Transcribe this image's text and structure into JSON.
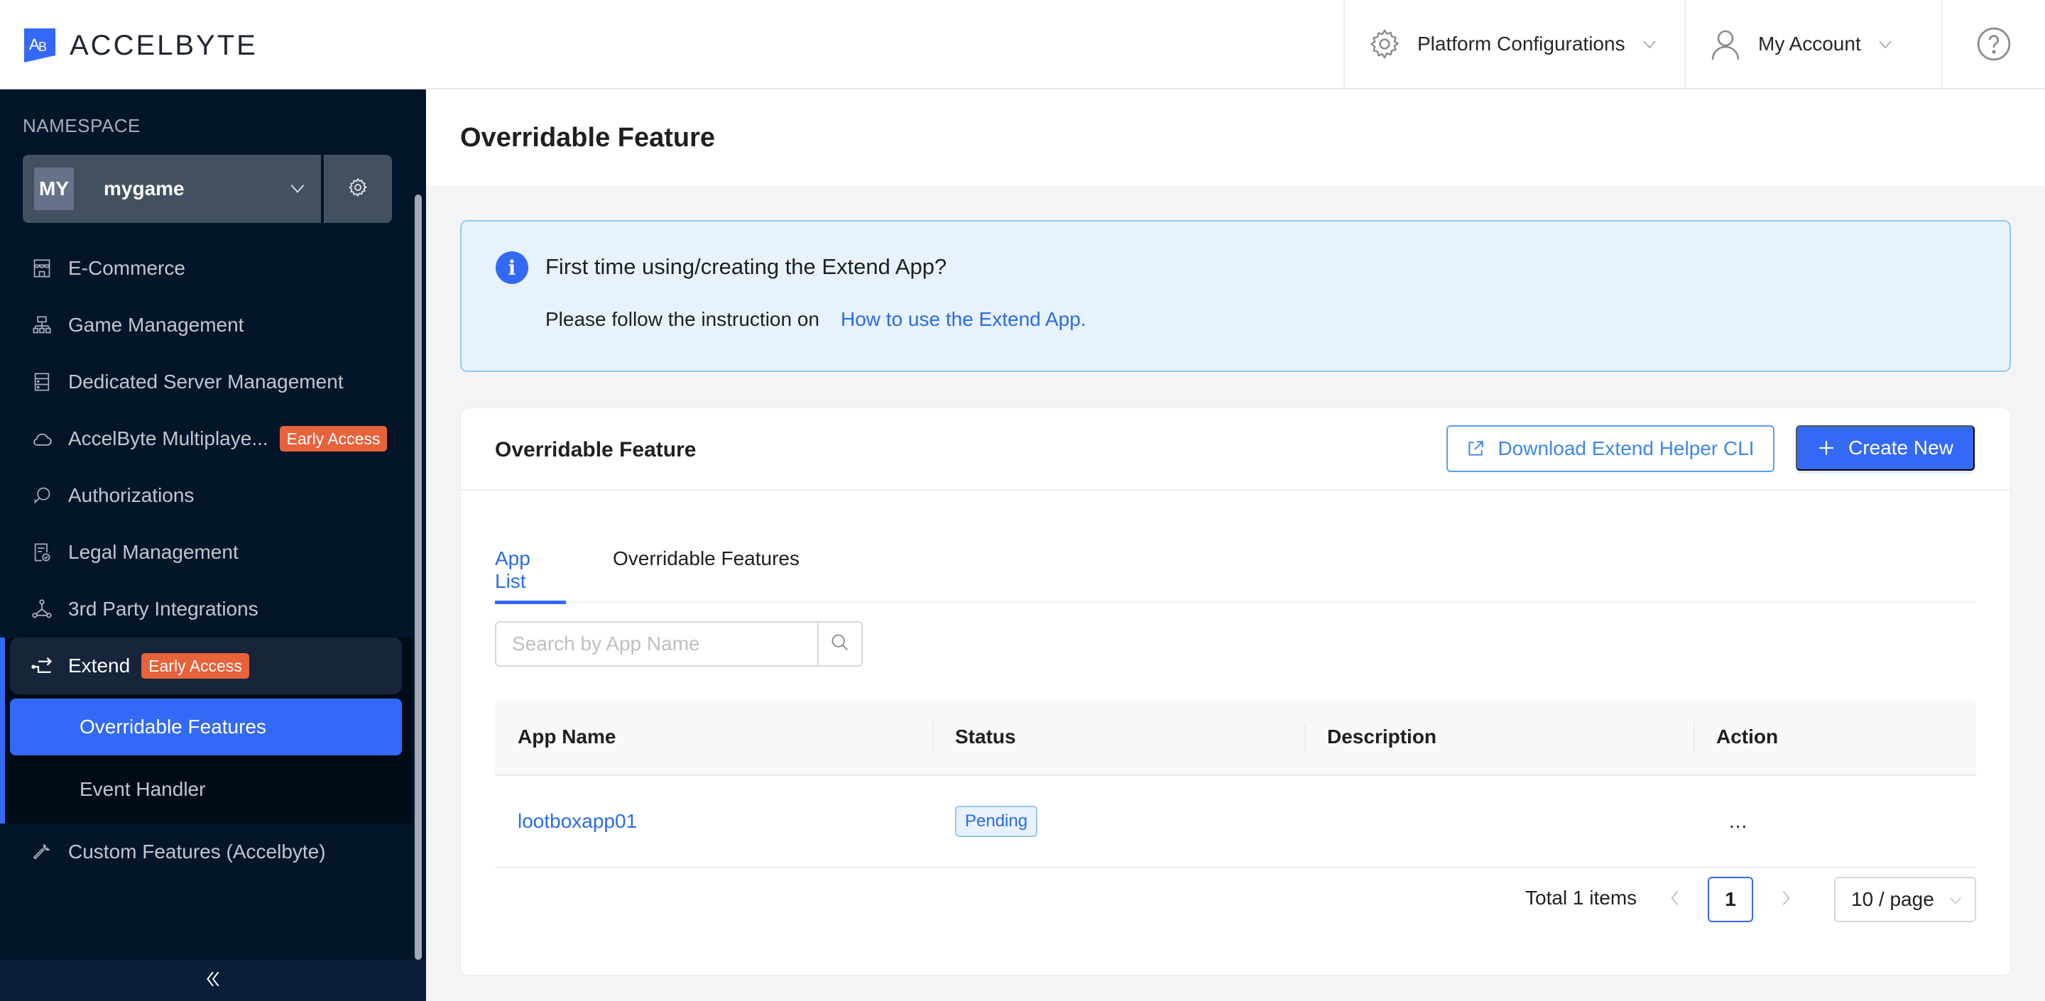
{
  "header": {
    "brand": "ACCELBYTE",
    "brand_mark": "AB",
    "platform_configurations": "Platform Configurations",
    "my_account": "My Account",
    "icons": {
      "platform": "gear-icon",
      "account": "user-icon",
      "help": "question-circle-icon"
    }
  },
  "sidebar": {
    "namespace_label": "NAMESPACE",
    "namespace": {
      "avatar": "MY",
      "name": "mygame"
    },
    "items": [
      {
        "label": "E-Commerce",
        "icon": "shop-icon"
      },
      {
        "label": "Game Management",
        "icon": "hierarchy-icon"
      },
      {
        "label": "Dedicated Server Management",
        "icon": "server-icon"
      },
      {
        "label": "AccelByte Multiplaye...",
        "icon": "cloud-icon",
        "badge": "Early Access"
      },
      {
        "label": "Authorizations",
        "icon": "key-icon"
      },
      {
        "label": "Legal Management",
        "icon": "legal-doc-icon"
      },
      {
        "label": "3rd Party Integrations",
        "icon": "integration-icon"
      },
      {
        "label": "Extend",
        "icon": "extend-icon",
        "badge": "Early Access",
        "expanded": true,
        "children": [
          {
            "label": "Overridable Features",
            "active": true
          },
          {
            "label": "Event Handler"
          }
        ]
      },
      {
        "label": "Custom Features (Accelbyte)",
        "icon": "wrench-icon"
      }
    ],
    "collapse_icon": "double-chevron-left-icon"
  },
  "main": {
    "page_title": "Overridable Feature",
    "alert": {
      "title": "First time using/creating the Extend App?",
      "body": "Please follow the instruction on",
      "link": "How to use the Extend App."
    },
    "card": {
      "title": "Overridable Feature",
      "download_button": "Download Extend Helper CLI",
      "create_button": "Create New",
      "tabs": [
        {
          "label": "App List",
          "active": true
        },
        {
          "label": "Overridable Features",
          "active": false
        }
      ],
      "search": {
        "placeholder": "Search by App Name",
        "value": ""
      },
      "table": {
        "columns": [
          "App Name",
          "Status",
          "Description",
          "Action"
        ],
        "rows": [
          {
            "app_name": "lootboxapp01",
            "status": "Pending",
            "description": "",
            "action": "..."
          }
        ]
      },
      "pagination": {
        "total": "Total 1 items",
        "current_page": "1",
        "page_size": "10 / page"
      }
    }
  },
  "colors": {
    "accent": "#3369f6",
    "sidebar_bg": "#031529",
    "badge_early_access": "#e8623a",
    "link": "#2a6be6"
  }
}
